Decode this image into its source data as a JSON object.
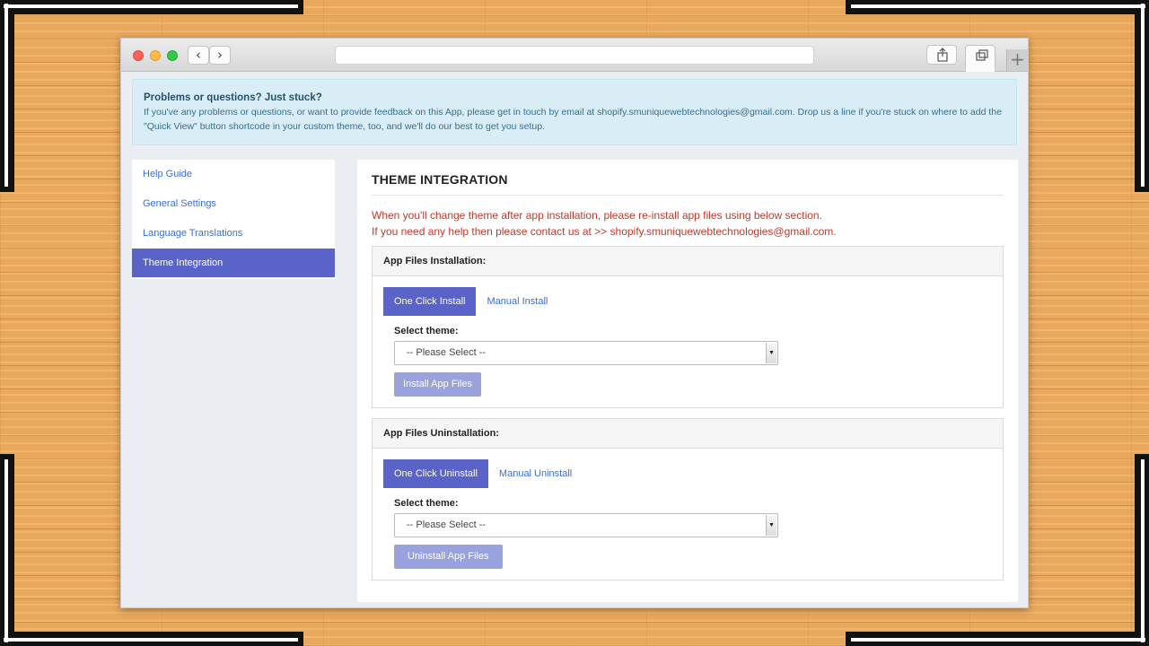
{
  "alert": {
    "title": "Problems or questions? Just stuck?",
    "body": "If you've any problems or questions, or want to provide feedback on this App, please get in touch by email at shopify.smuniquewebtechnologies@gmail.com. Drop us a line if you're stuck on where to add the \"Quick View\" button shortcode in your custom theme, too, and we'll do our best to get you setup."
  },
  "browser": {
    "back_icon": "chevron-left-icon",
    "forward_icon": "chevron-right-icon",
    "back_glyph": "‹",
    "forward_glyph": "›",
    "new_tab_glyph": "+"
  },
  "sidebar": {
    "items": [
      {
        "label": "Help Guide",
        "active": false
      },
      {
        "label": "General Settings",
        "active": false
      },
      {
        "label": "Language Translations",
        "active": false
      },
      {
        "label": "Theme Integration",
        "active": true
      }
    ]
  },
  "main": {
    "title": "THEME INTEGRATION",
    "notice_line1": "When you'll change theme after app installation, please re-install app files using below section.",
    "notice_line2": "If you need any help then please contact us at >> shopify.smuniquewebtechnologies@gmail.com.",
    "install": {
      "heading": "App Files Installation:",
      "tabs": [
        {
          "label": "One Click Install",
          "active": true
        },
        {
          "label": "Manual Install",
          "active": false
        }
      ],
      "select_label": "Select theme:",
      "select_value": "-- Please Select --",
      "button": "Install App Files"
    },
    "uninstall": {
      "heading": "App Files Uninstallation:",
      "tabs": [
        {
          "label": "One Click Uninstall",
          "active": true
        },
        {
          "label": "Manual Uninstall",
          "active": false
        }
      ],
      "select_label": "Select theme:",
      "select_value": "-- Please Select --",
      "button": "Uninstall App Files"
    }
  },
  "colors": {
    "accent": "#5a63c7",
    "button_disabled": "#9aa2de",
    "link": "#3a6ed2",
    "notice": "#c0392b",
    "alert_bg": "#d9edf7"
  }
}
